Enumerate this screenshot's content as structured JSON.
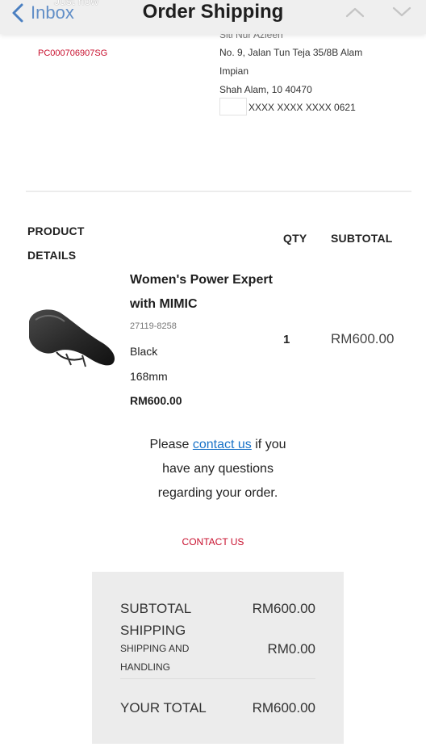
{
  "status": {
    "time": "Just now"
  },
  "nav": {
    "back_label": "Inbox",
    "title": "Order Shipping"
  },
  "shipping": {
    "tracking_number": "PC000706907SG",
    "recipient_partial": "Siti Nur Azleen",
    "address_line1": "No. 9, Jalan Tun Teja 35/8B Alam",
    "address_line2": "Impian",
    "address_line3": "Shah Alam, 10 40470",
    "card_masked": "XXXX XXXX XXXX 0621"
  },
  "table": {
    "col_product": "PRODUCT DETAILS",
    "col_qty": "QTY",
    "col_subtotal": "SUBTOTAL"
  },
  "product": {
    "name": "Women's Power Expert with MIMIC",
    "sku": "27119-8258",
    "color": "Black",
    "size": "168mm",
    "price": "RM600.00",
    "qty": "1",
    "subtotal": "RM600.00",
    "image_icon": "bike-saddle-image"
  },
  "help": {
    "prefix": "Please",
    "link": "contact us",
    "suffix": "if you have any questions regarding your order.",
    "contact_button": "CONTACT US"
  },
  "totals": {
    "subtotal_label": "SUBTOTAL",
    "subtotal_value": "RM600.00",
    "shipping_label": "SHIPPING",
    "shipping_handling_label": "SHIPPING AND HANDLING",
    "shipping_handling_value": "RM0.00",
    "total_label": "YOUR TOTAL",
    "total_value": "RM600.00"
  },
  "colors": {
    "accent_red": "#c8102e",
    "link_blue": "#1a73c8",
    "ios_blue": "#4a7fc1",
    "totals_bg": "#ececec"
  }
}
